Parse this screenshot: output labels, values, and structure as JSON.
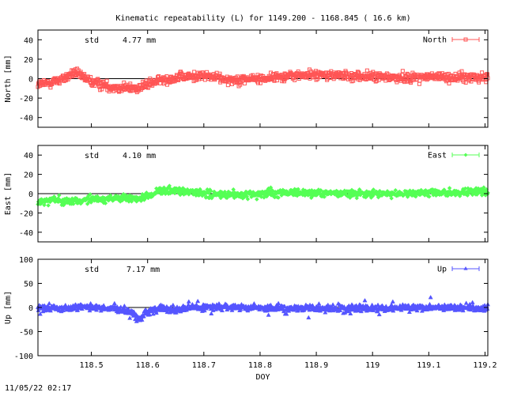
{
  "title": "Kinematic repeatability (L) for 1149.200 - 1168.845  ( 16.6 km)",
  "timestamp": "11/05/22 02:17",
  "chart_data": [
    {
      "type": "scatter",
      "id": "north",
      "ylabel": "North [mm]",
      "ylim": [
        -50,
        50
      ],
      "yticks": [
        -40,
        -20,
        0,
        20,
        40
      ],
      "xlim": [
        118.405,
        119.205
      ],
      "std_label": "std",
      "std_value": "4.77 mm",
      "legend": "North",
      "legend_position": "top-right",
      "color": "#ff5555",
      "marker": "square",
      "zero_line": true,
      "profile_x": [
        118.405,
        118.42,
        118.45,
        118.47,
        118.5,
        118.53,
        118.55,
        118.58,
        118.6,
        118.62,
        118.65,
        118.7,
        118.75,
        118.8,
        118.85,
        118.9,
        118.95,
        119.0,
        119.05,
        119.1,
        119.15,
        119.205
      ],
      "profile_y": [
        -6,
        -5,
        0,
        6,
        -3,
        -8,
        -9,
        -10,
        -6,
        -2,
        1,
        3,
        -1,
        0,
        3,
        4,
        3,
        2,
        1,
        2,
        1,
        2
      ],
      "scatter_mm": 6
    },
    {
      "type": "scatter",
      "id": "east",
      "ylabel": "East [mm]",
      "ylim": [
        -50,
        50
      ],
      "yticks": [
        -40,
        -20,
        0,
        20,
        40
      ],
      "xlim": [
        118.405,
        119.205
      ],
      "std_label": "std",
      "std_value": "4.10 mm",
      "legend": "East",
      "legend_position": "top-right",
      "color": "#55ff55",
      "marker": "diamond",
      "zero_line": true,
      "profile_x": [
        118.405,
        118.43,
        118.46,
        118.5,
        118.55,
        118.58,
        118.6,
        118.62,
        118.65,
        118.7,
        118.75,
        118.8,
        118.85,
        118.9,
        118.95,
        119.0,
        119.05,
        119.1,
        119.15,
        119.205
      ],
      "profile_y": [
        -10,
        -6,
        -8,
        -6,
        -5,
        -6,
        -3,
        3,
        3,
        0,
        -2,
        0,
        1,
        1,
        0,
        0,
        0,
        1,
        1,
        2
      ],
      "scatter_mm": 5
    },
    {
      "type": "scatter",
      "id": "up",
      "ylabel": "Up [mm]",
      "ylim": [
        -100,
        100
      ],
      "yticks": [
        -100,
        -50,
        0,
        50,
        100
      ],
      "xlim": [
        118.405,
        119.205
      ],
      "xticks": [
        118.5,
        118.6,
        118.7,
        118.8,
        118.9,
        119,
        119.1,
        119.2
      ],
      "xlabel": "DOY",
      "std_label": "std",
      "std_value": "7.17 mm",
      "legend": "Up",
      "legend_position": "top-right",
      "color": "#5555ff",
      "marker": "triangle",
      "zero_line": true,
      "profile_x": [
        118.405,
        118.45,
        118.5,
        118.55,
        118.57,
        118.585,
        118.6,
        118.62,
        118.65,
        118.7,
        118.8,
        118.9,
        119.0,
        119.1,
        119.205
      ],
      "profile_y": [
        0,
        -2,
        0,
        -3,
        -10,
        -25,
        -8,
        -3,
        -4,
        0,
        -1,
        -2,
        -2,
        -1,
        -1
      ],
      "scatter_mm": 8
    }
  ]
}
